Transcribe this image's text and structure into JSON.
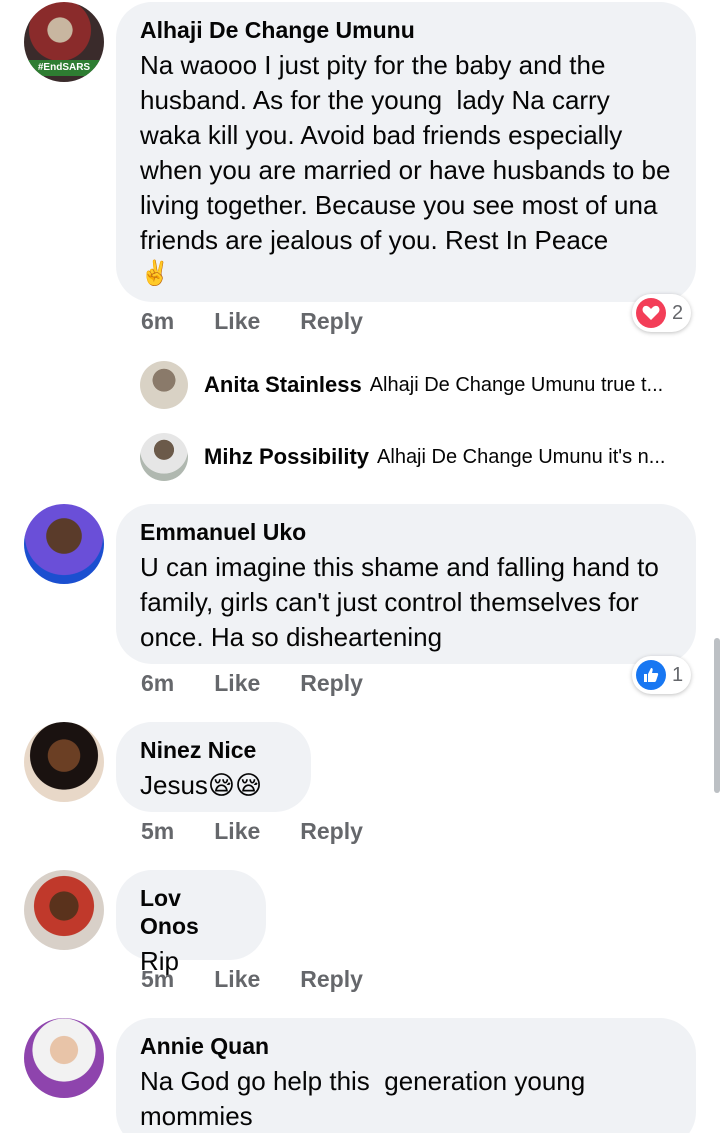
{
  "comments": [
    {
      "author": "Alhaji De Change Umunu",
      "text": "Na waooo I just pity for the baby and the husband. As for the young  lady Na carry waka kill you. Avoid bad friends especially when you are married or have husbands to be living together. Because you see most of una friends are jealous of you. Rest In Peace",
      "emoji": "✌️",
      "avatar_badge": "#EndSARS",
      "time": "6m",
      "like": "Like",
      "reply": "Reply",
      "reaction_count": "2",
      "reaction_icon": "love-icon"
    },
    {
      "author": "Emmanuel Uko",
      "text": "U can imagine this shame and falling hand to family, girls can't just control themselves for once. Ha so disheartening",
      "time": "6m",
      "like": "Like",
      "reply": "Reply",
      "reaction_count": "1",
      "reaction_icon": "like-icon"
    },
    {
      "author": "Ninez Nice",
      "text": "Jesus😪😪",
      "time": "5m",
      "like": "Like",
      "reply": "Reply"
    },
    {
      "author": "Lov Onos",
      "text": "Rip",
      "time": "5m",
      "like": "Like",
      "reply": "Reply"
    },
    {
      "author": "Annie Quan",
      "text": "Na God go help this  generation young mommies"
    }
  ],
  "replies": [
    {
      "author": "Anita Stainless",
      "text": "Alhaji De Change Umunu true t..."
    },
    {
      "author": "Mihz Possibility",
      "text": "Alhaji De Change Umunu it's n..."
    }
  ],
  "colors": {
    "bubble": "#f0f2f5",
    "meta": "#65676b",
    "love": "#f33e58",
    "like": "#1877f2"
  }
}
